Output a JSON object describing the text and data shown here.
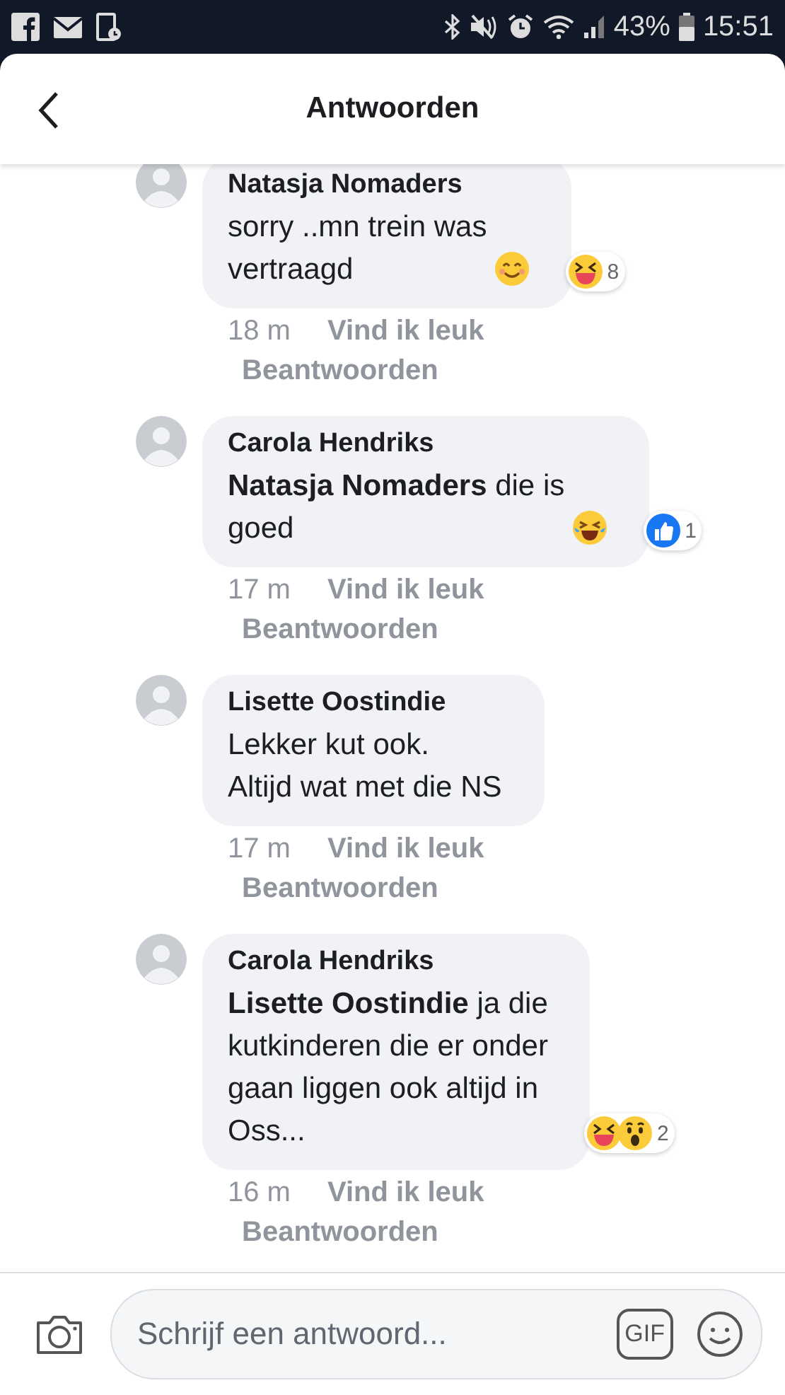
{
  "status_bar": {
    "battery": "43%",
    "time": "15:51"
  },
  "header": {
    "title": "Antwoorden"
  },
  "comments": [
    {
      "author": "Natasja Nomaders",
      "text": "sorry ..mn trein was\nvertraagd",
      "emoji": {
        "kind": "smile"
      },
      "time": "18 m",
      "like": "Vind ik leuk",
      "reply": "Beantwoorden",
      "reactions": [
        {
          "kind": "haha"
        }
      ],
      "reaction_count": "8"
    },
    {
      "author": "Carola Hendriks",
      "text": "**Natasja Nomaders** die is\ngoed",
      "emoji": {
        "kind": "tears"
      },
      "time": "17 m",
      "like": "Vind ik leuk",
      "reply": "Beantwoorden",
      "reactions": [
        {
          "kind": "like"
        }
      ],
      "reaction_count": "1"
    },
    {
      "author": "Lisette Oostindie",
      "text": "Lekker kut ook.\nAltijd wat met die NS",
      "time": "17 m",
      "like": "Vind ik leuk",
      "reply": "Beantwoorden"
    },
    {
      "author": "Carola Hendriks",
      "text": "**Lisette Oostindie** ja die\nkutkinderen die er onder\ngaan liggen ook altijd in\nOss...",
      "time": "16 m",
      "like": "Vind ik leuk",
      "reply": "Beantwoorden",
      "reactions": [
        {
          "kind": "haha"
        },
        {
          "kind": "wow"
        }
      ],
      "reaction_count": "2"
    }
  ],
  "composer": {
    "placeholder": "Schrijf een antwoord...",
    "gif": "GIF"
  }
}
